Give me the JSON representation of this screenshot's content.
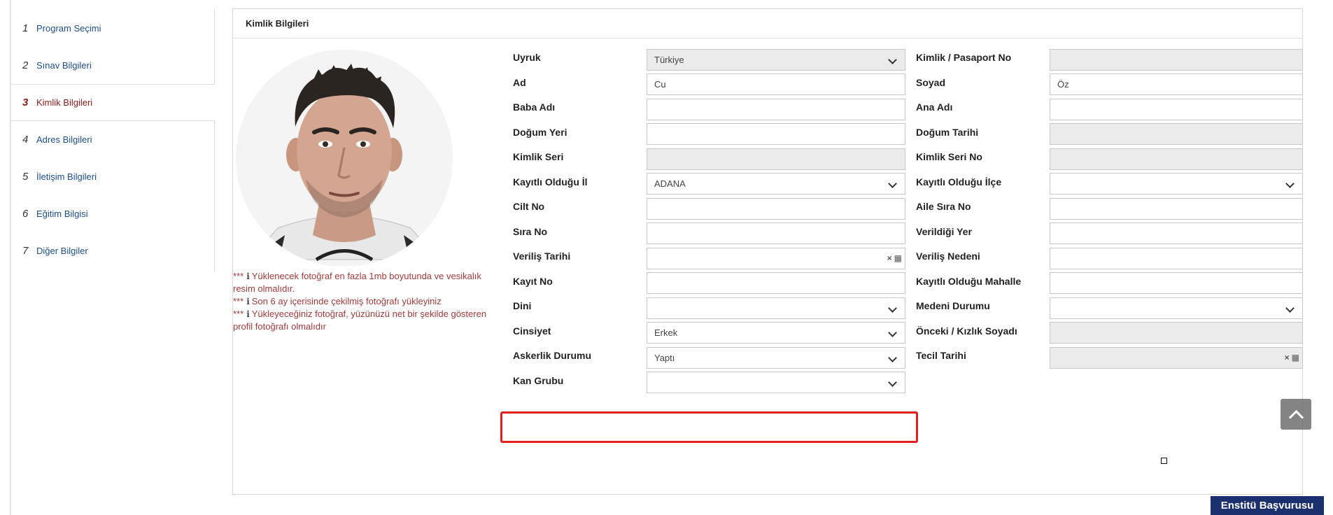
{
  "sidebar": {
    "steps": [
      {
        "num": "1",
        "label": "Program Seçimi"
      },
      {
        "num": "2",
        "label": "Sınav Bilgileri"
      },
      {
        "num": "3",
        "label": "Kimlik Bilgileri"
      },
      {
        "num": "4",
        "label": "Adres Bilgileri"
      },
      {
        "num": "5",
        "label": "İletişim Bilgileri"
      },
      {
        "num": "6",
        "label": "Eğitim Bilgisi"
      },
      {
        "num": "7",
        "label": "Diğer Bilgiler"
      }
    ]
  },
  "panel": {
    "title": "Kimlik Bilgileri"
  },
  "notes": [
    {
      "prefix": "***",
      "icon": "i",
      "text": "Yüklenecek fotoğraf en fazla 1mb boyutunda ve vesikalık resim olmalıdır."
    },
    {
      "prefix": "***",
      "icon": "i",
      "text": "Son 6 ay içerisinde çekilmiş fotoğrafı yükleyiniz"
    },
    {
      "prefix": "***",
      "icon": "i",
      "text": "Yükleyeceğiniz fotoğraf, yüzünüzü net bir şekilde gösteren profil fotoğrafı olmalıdır"
    }
  ],
  "form": {
    "left": {
      "uyruk": {
        "label": "Uyruk",
        "value": "Türkiye"
      },
      "ad": {
        "label": "Ad",
        "value": "Cu"
      },
      "baba_adi": {
        "label": "Baba Adı",
        "value": ""
      },
      "dogum_yeri": {
        "label": "Doğum Yeri",
        "value": ""
      },
      "kimlik_seri": {
        "label": "Kimlik Seri",
        "value": ""
      },
      "kayitli_il": {
        "label": "Kayıtlı Olduğu İl",
        "value": "ADANA"
      },
      "cilt_no": {
        "label": "Cilt No",
        "value": ""
      },
      "sira_no": {
        "label": "Sıra No",
        "value": ""
      },
      "verilis_tarihi": {
        "label": "Veriliş Tarihi",
        "value": ""
      },
      "kayit_no": {
        "label": "Kayıt No",
        "value": ""
      },
      "dini": {
        "label": "Dini",
        "value": ""
      },
      "cinsiyet": {
        "label": "Cinsiyet",
        "value": "Erkek"
      },
      "askerlik": {
        "label": "Askerlik Durumu",
        "value": "Yaptı"
      },
      "kan_grubu": {
        "label": "Kan Grubu",
        "value": ""
      }
    },
    "right": {
      "kimlik_no": {
        "label": "Kimlik / Pasaport No",
        "value": ""
      },
      "soyad": {
        "label": "Soyad",
        "value": "Öz"
      },
      "ana_adi": {
        "label": "Ana Adı",
        "value": ""
      },
      "dogum_tarihi": {
        "label": "Doğum Tarihi",
        "value": ""
      },
      "kimlik_seri_no": {
        "label": "Kimlik Seri No",
        "value": ""
      },
      "kayitli_ilce": {
        "label": "Kayıtlı Olduğu İlçe",
        "value": ""
      },
      "aile_sira_no": {
        "label": "Aile Sıra No",
        "value": ""
      },
      "verildigi_yer": {
        "label": "Verildiği Yer",
        "value": ""
      },
      "verilis_nedeni": {
        "label": "Veriliş Nedeni",
        "value": ""
      },
      "kayitli_mahalle": {
        "label": "Kayıtlı Olduğu Mahalle",
        "value": ""
      },
      "medeni_durum": {
        "label": "Medeni Durumu",
        "value": ""
      },
      "onceki_soyad": {
        "label": "Önceki / Kızlık Soyadı",
        "value": ""
      },
      "tecil_tarihi": {
        "label": "Tecil Tarihi",
        "value": ""
      }
    }
  },
  "calendar_clear_glyph": "×",
  "calendar_icon_glyph": "▦",
  "submit_label": "Enstitü Başvurusu",
  "colors": {
    "highlight": "#e3201f",
    "active_step": "#8b1a1a",
    "step_link": "#1f4e8c",
    "note_text": "#a33a3a",
    "submit_bg": "#1c2f6e"
  }
}
